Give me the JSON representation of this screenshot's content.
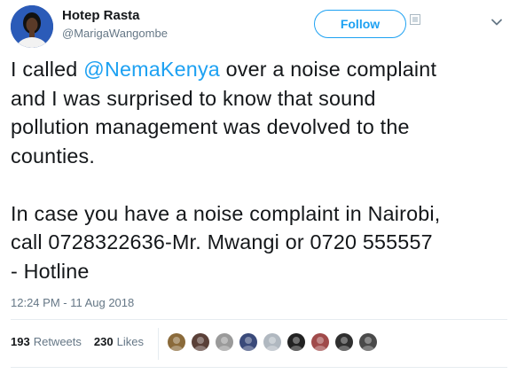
{
  "author": {
    "name": "Hotep Rasta",
    "handle": "@MarigaWangombe"
  },
  "follow_button": {
    "label": "Follow"
  },
  "tweet": {
    "line1_prefix": "I called ",
    "mention": "@NemaKenya",
    "line1_suffix": " over a noise complaint\nand I was surprised to know that sound\npollution management was devolved to the\ncounties.\n\nIn case you have a noise complaint in Nairobi,\ncall 0728322636-Mr. Mwangi or 0720 555557\n- Hotline"
  },
  "timestamp": "12:24 PM - 11 Aug 2018",
  "stats": {
    "retweets_count": "193",
    "retweets_label": "Retweets",
    "likes_count": "230",
    "likes_label": "Likes"
  },
  "colors": {
    "accent": "#1da1f2",
    "text": "#14171a",
    "secondary": "#657786"
  },
  "liker_avatars": [
    {
      "color": "#8a6a3a"
    },
    {
      "color": "#5a4038"
    },
    {
      "color": "#9a9a9a"
    },
    {
      "color": "#3a4a7a"
    },
    {
      "color": "#b0b8c0"
    },
    {
      "color": "#222222"
    },
    {
      "color": "#a04a4a"
    },
    {
      "color": "#2f2f2f"
    },
    {
      "color": "#4a4a4a"
    }
  ]
}
